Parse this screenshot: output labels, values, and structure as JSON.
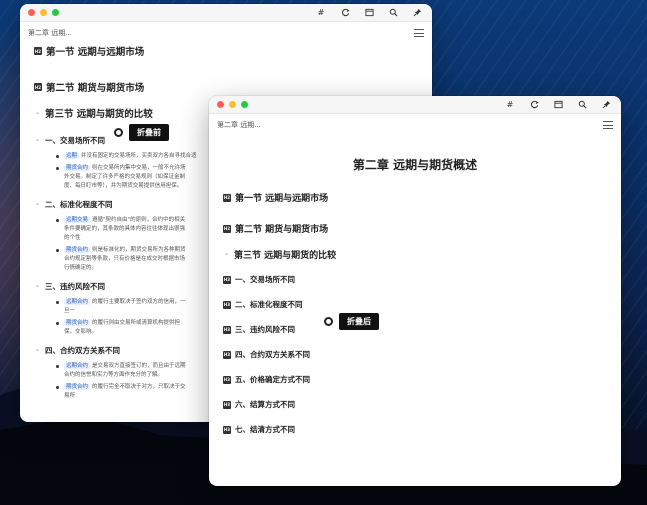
{
  "back_window": {
    "breadcrumb": "第二章 远期...",
    "sections": [
      {
        "label": "第一节 远期与远期市场"
      },
      {
        "label": "第二节 期货与期货市场"
      },
      {
        "label": "第三节 远期与期货的比较"
      }
    ],
    "subsections": [
      {
        "label": "一、交易场所不同",
        "paras": [
          {
            "tag": "远期",
            "text": "并没有固定的交易场所，买卖双方各自寻找合适"
          },
          {
            "tag": "期货合约",
            "text": "则在交易所内集中交易，一般不允许场外交易。制定了许多严格的交易规则（如保证金制度、每日盯市等），并为期货交易提供信用担保。"
          }
        ]
      },
      {
        "label": "二、标准化程度不同",
        "paras": [
          {
            "tag": "远期交易",
            "text": "遵循\"契约自由\"的原则，合约中的相关条件要确定的，其条款的具体内容往往体现出很强的个性"
          },
          {
            "tag": "期货合约",
            "text": "则是标准化的，期货交易所为各种期货合约规定割等条款，只有价格是在成交时根据市场行情确定的。"
          }
        ]
      },
      {
        "label": "三、违约风险不同",
        "paras": [
          {
            "tag": "远期合约",
            "text": "的履行主要取决于签约双方的信用，一旦一"
          },
          {
            "tag": "期货合约",
            "text": "的履行则由交易所或清算机构提供担保，交影响。"
          }
        ]
      },
      {
        "label": "四、合约双方关系不同",
        "paras": [
          {
            "tag": "远期合约",
            "text": "是交易双方直接签订的，而且由于远期合约的信誉和实力等方面作充分的了解。"
          },
          {
            "tag": "期货合约",
            "text": "的履行完全不取决于对方，只取决于交易所"
          }
        ]
      }
    ]
  },
  "front_window": {
    "breadcrumb": "第二章 远期...",
    "chapter_title": "第二章 远期与期货概述",
    "sections": [
      {
        "label": "第一节 远期与远期市场"
      },
      {
        "label": "第二节 期货与期货市场"
      },
      {
        "label": "第三节 远期与期货的比较"
      }
    ],
    "subsections": [
      {
        "label": "一、交易场所不同"
      },
      {
        "label": "二、标准化程度不同"
      },
      {
        "label": "三、违约风险不同"
      },
      {
        "label": "四、合约双方关系不同"
      },
      {
        "label": "五、价格确定方式不同"
      },
      {
        "label": "六、结算方式不同"
      },
      {
        "label": "七、结清方式不同"
      }
    ]
  },
  "toolbar": {
    "icons": [
      "hash-icon",
      "refresh-icon",
      "window-icon",
      "search-icon",
      "pin-icon"
    ],
    "hash_glyph": "#"
  },
  "callouts": {
    "before": "折叠前",
    "after": "折叠后"
  },
  "colors": {
    "tag_bg": "#e6efff",
    "tag_text": "#2b5fb8",
    "callout_bg": "#111111"
  }
}
